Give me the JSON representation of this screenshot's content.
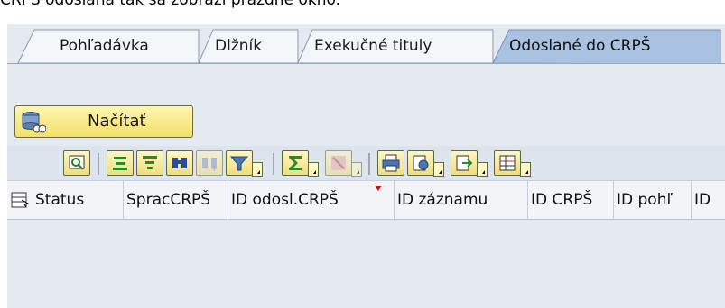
{
  "caption": "CRPS odoslaná tak sa zobrazí prázdne okno.",
  "tabs": [
    {
      "label": "Pohľadávka",
      "active": false
    },
    {
      "label": "Dlžník",
      "active": false
    },
    {
      "label": "Exekučné tituly",
      "active": false
    },
    {
      "label": "Odoslané do CRPŠ",
      "active": true
    }
  ],
  "load_button": {
    "label": "Načítať",
    "icon": "database-load-icon"
  },
  "toolbar_icons": [
    "details-icon",
    "sort-ascending-icon",
    "sort-descending-icon",
    "find-icon",
    "find-next-icon",
    "filter-icon",
    "sum-icon",
    "subtotals-icon",
    "print-icon",
    "views-icon",
    "export-icon",
    "layout-grid-icon"
  ],
  "columns": [
    "Status",
    "SpracCRPŠ",
    "ID odosl.CRPŠ",
    "ID záznamu",
    "ID CRPŠ",
    "ID pohľ",
    "ID"
  ],
  "colors": {
    "panel": "#e5eaf1",
    "tab_active": "#a9c2e2",
    "tab_inactive": "#f3f6f9",
    "button": "#f4df6a"
  }
}
